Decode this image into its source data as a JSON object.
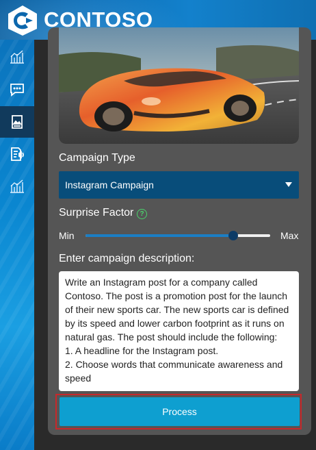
{
  "header": {
    "brand": "CONTOSO"
  },
  "sidebar": {
    "items": [
      {
        "icon": "chart-icon"
      },
      {
        "icon": "chat-icon"
      },
      {
        "icon": "image-icon",
        "active": true
      },
      {
        "icon": "document-speaker-icon"
      },
      {
        "icon": "chart-icon"
      }
    ]
  },
  "form": {
    "campaign_type_label": "Campaign Type",
    "campaign_type_value": "Instagram Campaign",
    "surprise_label": "Surprise Factor",
    "surprise_min": "Min",
    "surprise_max": "Max",
    "surprise_level": 0.8,
    "description_label": "Enter campaign description:",
    "description_text": "Write an Instagram post for a company called Contoso. The post is a promotion post for the launch of their new sports car. The new sports car is defined by its speed and lower carbon footprint as it runs on natural gas. The post should include the following:\n1. A headline for the Instagram post.\n2. Choose words that communicate awareness and speed",
    "process_label": "Process"
  },
  "colors": {
    "accent": "#0e9fd0",
    "select_bg": "#084d7a",
    "highlight_border": "#c7282b"
  }
}
